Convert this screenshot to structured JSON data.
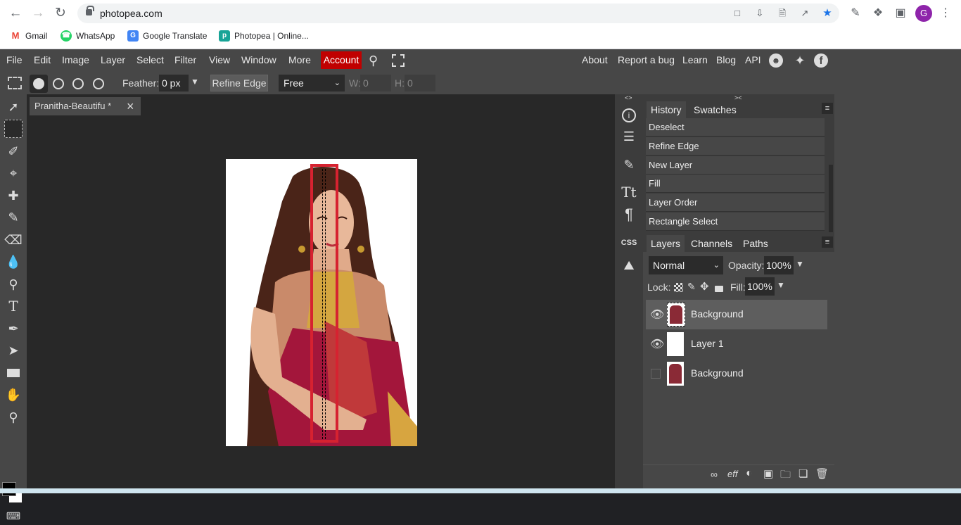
{
  "browser": {
    "url": "photopea.com",
    "bookmarks": [
      {
        "label": "Gmail",
        "icon": "gmail-icon",
        "color": "#ea4335"
      },
      {
        "label": "WhatsApp",
        "icon": "whatsapp-icon",
        "color": "#25d366"
      },
      {
        "label": "Google Translate",
        "icon": "google-translate-icon",
        "color": "#4285f4"
      },
      {
        "label": "Photopea | Online...",
        "icon": "photopea-icon",
        "color": "#18a497"
      }
    ],
    "profile_initial": "G"
  },
  "menubar": {
    "items": [
      "File",
      "Edit",
      "Image",
      "Layer",
      "Select",
      "Filter",
      "View",
      "Window",
      "More"
    ],
    "account": "Account",
    "right_links": [
      "About",
      "Report a bug",
      "Learn",
      "Blog",
      "API"
    ]
  },
  "options": {
    "feather_label": "Feather:",
    "feather_value": "0 px",
    "refine_edge": "Refine Edge",
    "style_value": "Free",
    "w_label": "W:",
    "w_value": "0",
    "h_label": "H:",
    "h_value": "0"
  },
  "document": {
    "tab_title": "Pranitha-Beautifu *",
    "close": "×"
  },
  "history_panel": {
    "tabs": [
      "History",
      "Swatches"
    ],
    "items": [
      "Deselect",
      "Refine Edge",
      "New Layer",
      "Fill",
      "Layer Order",
      "Rectangle Select"
    ]
  },
  "layers_panel": {
    "tabs": [
      "Layers",
      "Channels",
      "Paths"
    ],
    "blend_mode": "Normal",
    "opacity_label": "Opacity:",
    "opacity_value": "100%",
    "lock_label": "Lock:",
    "fill_label": "Fill:",
    "fill_value": "100%",
    "layers": [
      {
        "name": "Background",
        "visible": true,
        "selected": true
      },
      {
        "name": "Layer 1",
        "visible": true,
        "selected": false
      },
      {
        "name": "Background",
        "visible": false,
        "selected": false
      }
    ]
  },
  "sidebar_labels": {
    "css": "CSS"
  },
  "colors": {
    "accent_red": "#c00000",
    "selection_box": "#d62230",
    "panel_bg": "#3c3c3c",
    "app_bg": "#474747",
    "canvas_bg": "#282828"
  }
}
